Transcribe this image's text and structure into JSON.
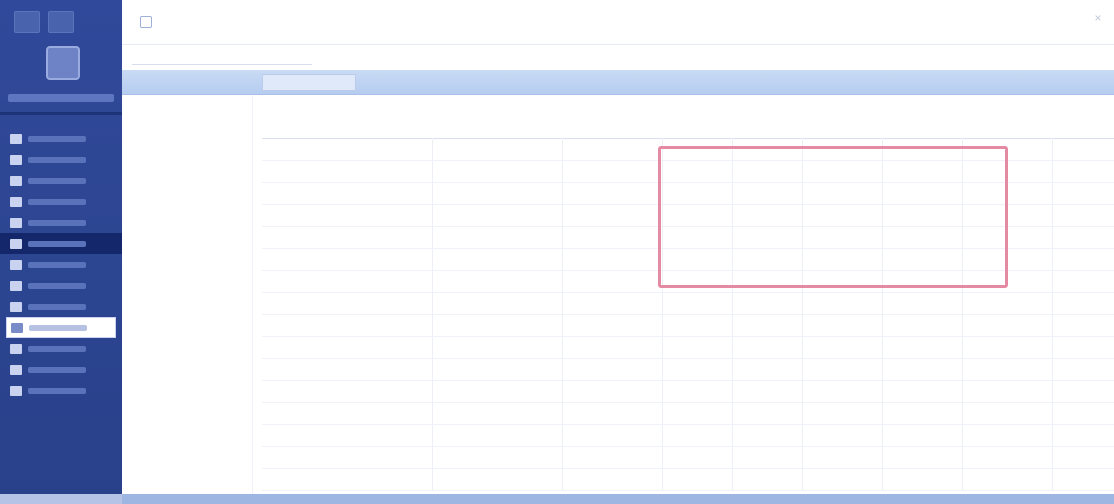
{
  "window": {
    "title": ""
  },
  "breadcrumb": "",
  "tabs": [
    {
      "label": ""
    },
    {
      "label": ""
    }
  ],
  "left_panel_label": "",
  "sidebar": {
    "items": [
      {
        "label": "",
        "icon": "doc-icon"
      },
      {
        "label": "",
        "icon": "doc-icon"
      },
      {
        "label": "",
        "icon": "doc-icon"
      },
      {
        "label": "",
        "icon": "doc-icon"
      },
      {
        "label": "",
        "icon": "doc-icon"
      },
      {
        "label": "",
        "icon": "doc-icon"
      },
      {
        "label": "",
        "icon": "doc-icon"
      },
      {
        "label": "",
        "icon": "doc-icon"
      },
      {
        "label": "",
        "icon": "doc-icon"
      },
      {
        "label": "",
        "icon": "doc-icon"
      },
      {
        "label": "",
        "icon": "doc-icon"
      },
      {
        "label": "",
        "icon": "doc-icon"
      },
      {
        "label": "",
        "icon": "doc-icon"
      }
    ]
  },
  "table": {
    "group_title": "",
    "columns": [
      "",
      "",
      "",
      "",
      "",
      "",
      "",
      "",
      ""
    ],
    "rows": [
      [
        "",
        "",
        "",
        "",
        "",
        "",
        "",
        "",
        ""
      ],
      [
        "",
        "",
        "",
        "",
        "",
        "",
        "",
        "",
        ""
      ],
      [
        "",
        "",
        "",
        "",
        "",
        "",
        "",
        "",
        ""
      ],
      [
        "",
        "",
        "",
        "",
        "",
        "",
        "",
        "",
        ""
      ],
      [
        "",
        "",
        "",
        "",
        "",
        "",
        "",
        "",
        ""
      ],
      [
        "",
        "",
        "",
        "",
        "",
        "",
        "",
        "",
        ""
      ],
      [
        "",
        "",
        "",
        "",
        "",
        "",
        "",
        "",
        ""
      ],
      [
        "",
        "",
        "",
        "",
        "",
        "",
        "",
        "",
        ""
      ],
      [
        "",
        "",
        "",
        "",
        "",
        "",
        "",
        "",
        ""
      ],
      [
        "",
        "",
        "",
        "",
        "",
        "",
        "",
        "",
        ""
      ],
      [
        "",
        "",
        "",
        "",
        "",
        "",
        "",
        "",
        ""
      ],
      [
        "",
        "",
        "",
        "",
        "",
        "",
        "",
        "",
        ""
      ],
      [
        "",
        "",
        "",
        "",
        "",
        "",
        "",
        "",
        ""
      ],
      [
        "",
        "",
        "",
        "",
        "",
        "",
        "",
        "",
        ""
      ],
      [
        "",
        "",
        "",
        "",
        "",
        "",
        "",
        "",
        ""
      ],
      [
        "",
        "",
        "",
        "",
        "",
        "",
        "",
        "",
        ""
      ]
    ]
  },
  "colors": {
    "sidebar": "#2c4590",
    "tabbar": "#c9dbf4",
    "highlight": "#e48aa2"
  }
}
